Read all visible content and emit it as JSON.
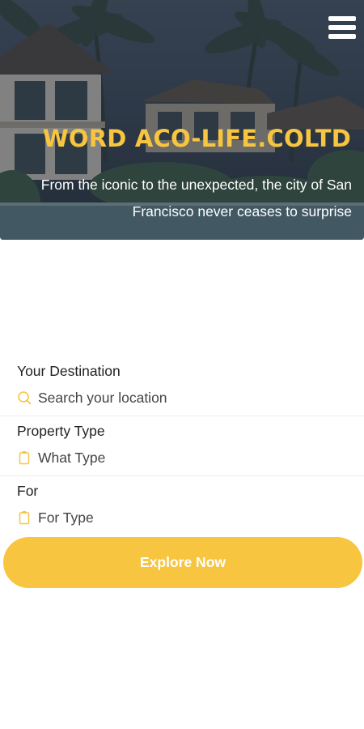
{
  "hero": {
    "title": "WORD ACO-LIFE.COLTD",
    "subtitle": "From the iconic to the unexpected, the city of San Francisco never ceases to surprise",
    "menu_icon": "hamburger-menu-icon"
  },
  "form": {
    "destination": {
      "label": "Your Destination",
      "value": "Search your location",
      "icon": "search-icon"
    },
    "property_type": {
      "label": "Property Type",
      "value": "What Type",
      "icon": "clipboard-icon"
    },
    "for": {
      "label": "For",
      "value": "For Type",
      "icon": "clipboard-icon"
    }
  },
  "explore_button": {
    "label": "Explore Now"
  },
  "colors": {
    "accent": "#f7c53f",
    "text": "#222222"
  }
}
